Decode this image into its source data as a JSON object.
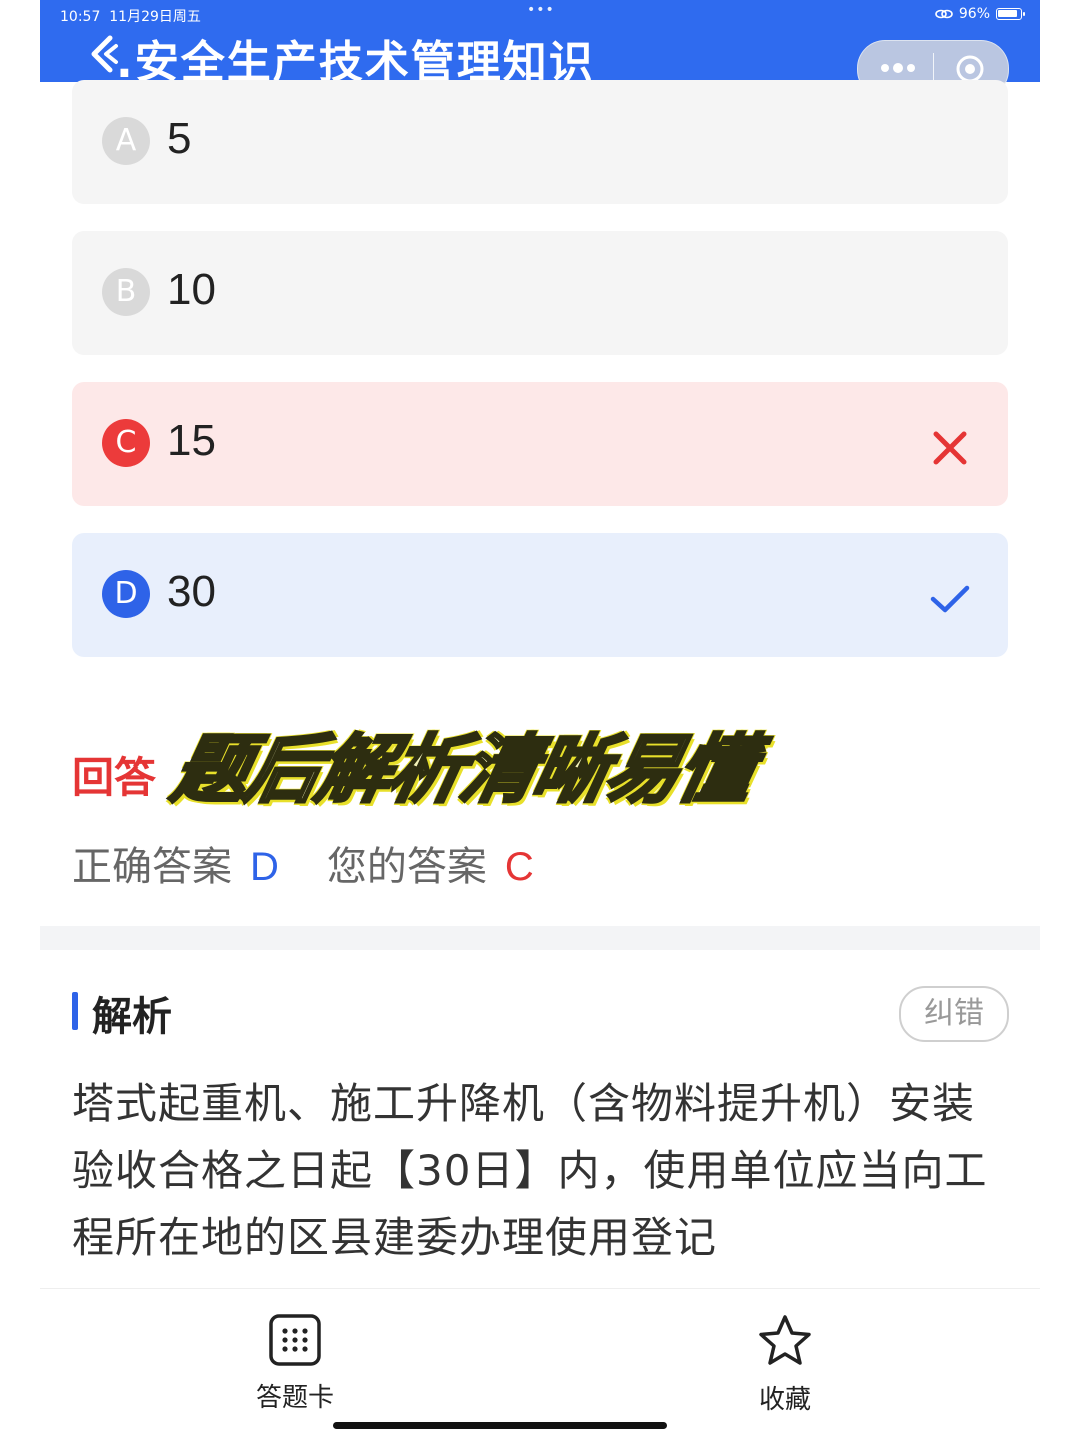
{
  "status_bar": {
    "time": "10:57",
    "date": "11月29日周五",
    "battery": "96%"
  },
  "header": {
    "title": "安全生产技术管理知识"
  },
  "options": [
    {
      "letter": "A",
      "text": "5"
    },
    {
      "letter": "B",
      "text": "10"
    },
    {
      "letter": "C",
      "text": "15",
      "state": "wrong"
    },
    {
      "letter": "D",
      "text": "30",
      "state": "correct"
    }
  ],
  "answer": {
    "title": "回答",
    "overlay_text": "题后解析清晰易懂",
    "correct_label": "正确答案",
    "correct_value": "D",
    "yours_label": "您的答案",
    "yours_value": "C"
  },
  "analysis": {
    "title": "解析",
    "report_button": "纠错",
    "text": "塔式起重机、施工升降机（含物料提升机）安装验收合格之日起【30日】内，使用单位应当向工程所在地的区县建委办理使用登记"
  },
  "bottom_bar": {
    "answer_card_label": "答题卡",
    "favorite_label": "收藏"
  },
  "colors": {
    "brand": "#2f6bef",
    "correct": "#2e63e8",
    "wrong": "#e53535"
  }
}
